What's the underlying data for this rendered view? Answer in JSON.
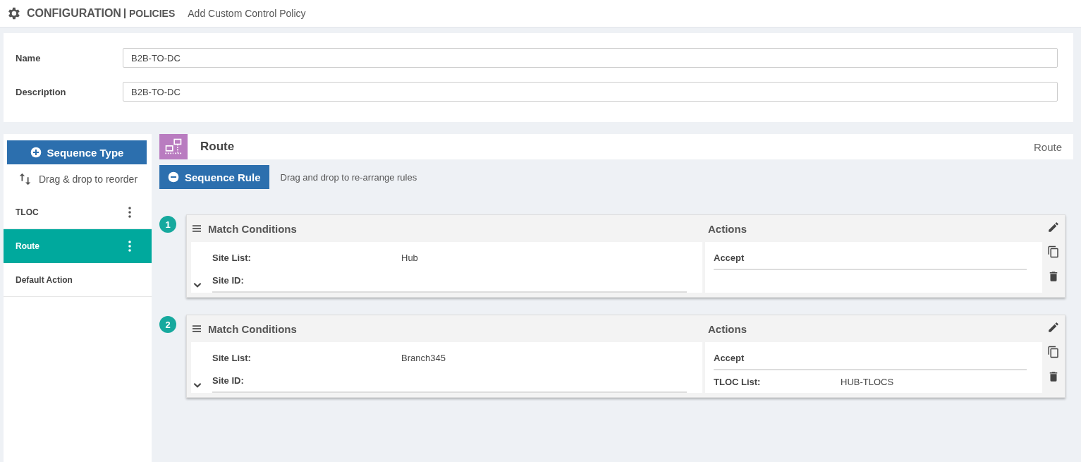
{
  "header": {
    "title": "CONFIGURATION",
    "subtitle": "POLICIES",
    "page": "Add Custom Control Policy"
  },
  "form": {
    "fields": [
      {
        "label": "Name",
        "value": "B2B-TO-DC"
      },
      {
        "label": "Description",
        "value": "B2B-TO-DC"
      }
    ]
  },
  "sidebar": {
    "add_button": "Sequence Type",
    "hint": "Drag & drop to reorder",
    "items": [
      {
        "label": "TLOC",
        "selected": false,
        "menu": true
      },
      {
        "label": "Route",
        "selected": true,
        "menu": true
      },
      {
        "label": "Default Action",
        "selected": false,
        "menu": false
      }
    ]
  },
  "main": {
    "title": "Route",
    "type_label": "Route",
    "add_button": "Sequence Rule",
    "hint": "Drag and drop to re-arrange rules",
    "rules": [
      {
        "number": "1",
        "match_title": "Match Conditions",
        "match": [
          {
            "label": "Site List:",
            "value": "Hub"
          },
          {
            "label": "Site ID:"
          }
        ],
        "actions_title": "Actions",
        "actions": [
          {
            "label": "Accept"
          }
        ]
      },
      {
        "number": "2",
        "match_title": "Match Conditions",
        "match": [
          {
            "label": "Site List:",
            "value": "Branch345"
          },
          {
            "label": "Site ID:"
          }
        ],
        "actions_title": "Actions",
        "actions": [
          {
            "label": "Accept"
          },
          {
            "label": "TLOC List:",
            "value": "HUB-TLOCS"
          }
        ]
      }
    ]
  }
}
